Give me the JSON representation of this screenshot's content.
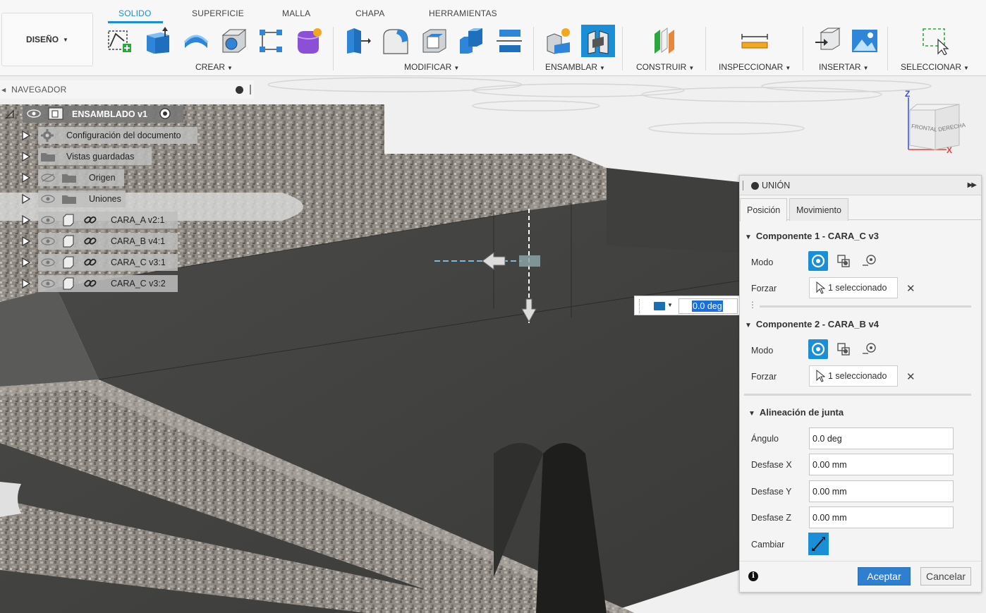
{
  "toolbar": {
    "workspace": "DISEÑO",
    "tabs": [
      "SOLIDO",
      "SUPERFICIE",
      "MALLA",
      "CHAPA",
      "HERRAMIENTAS"
    ],
    "groups": {
      "crear": "CREAR",
      "modificar": "MODIFICAR",
      "ensamblar": "ENSAMBLAR",
      "construir": "CONSTRUIR",
      "inspeccionar": "INSPECCIONAR",
      "insertar": "INSERTAR",
      "seleccionar": "SELECCIONAR"
    },
    "caret": "▼",
    "icons": [
      "sketch-icon",
      "extrude-icon",
      "revolve-icon",
      "box-icon",
      "pattern-icon",
      "form-icon",
      "press-pull-icon",
      "fillet-icon",
      "shell-icon",
      "combine-icon",
      "split-icon",
      "new-component-icon",
      "joint-icon",
      "offset-plane-icon",
      "measure-icon",
      "insert-derive-icon",
      "insert-canvas-icon",
      "select-window-icon"
    ],
    "accent": "#1a8fd8"
  },
  "navigator": {
    "title": "NAVEGADOR",
    "root": "ENSAMBLADO v1",
    "items": [
      {
        "label": "Configuración del documento",
        "icon": "gear-icon"
      },
      {
        "label": "Vistas guardadas",
        "icon": "folder-icon"
      },
      {
        "label": "Origen",
        "icon": "folder-icon",
        "hidden": true
      },
      {
        "label": "Uniones",
        "icon": "folder-icon"
      },
      {
        "label": "CARA_A v2:1",
        "icon": "component-icon"
      },
      {
        "label": "CARA_B v4:1",
        "icon": "component-icon"
      },
      {
        "label": "CARA_C v3:1",
        "icon": "component-icon"
      },
      {
        "label": "CARA_C v3:2",
        "icon": "component-icon"
      }
    ]
  },
  "viewcube": {
    "top": "Z",
    "x_axis": "X",
    "front": "FRONTAL",
    "right": "DERECHA"
  },
  "angle_input": {
    "value": "0.0 deg"
  },
  "joint_panel": {
    "title": "UNIÓN",
    "tabs": [
      "Posición",
      "Movimiento"
    ],
    "component1": {
      "title": "Componente 1 - CARA_C v3",
      "mode_label": "Modo",
      "force_label": "Forzar",
      "selection": "1 seleccionado"
    },
    "component2": {
      "title": "Componente 2 - CARA_B v4",
      "mode_label": "Modo",
      "force_label": "Forzar",
      "selection": "1 seleccionado"
    },
    "alignment": {
      "title": "Alineación de junta",
      "angle_label": "Ángulo",
      "angle_value": "0.0 deg",
      "offset_x_label": "Desfase X",
      "offset_x_value": "0.00 mm",
      "offset_y_label": "Desfase Y",
      "offset_y_value": "0.00 mm",
      "offset_z_label": "Desfase Z",
      "offset_z_value": "0.00 mm",
      "flip_label": "Cambiar"
    },
    "ok": "Aceptar",
    "cancel": "Cancelar"
  }
}
